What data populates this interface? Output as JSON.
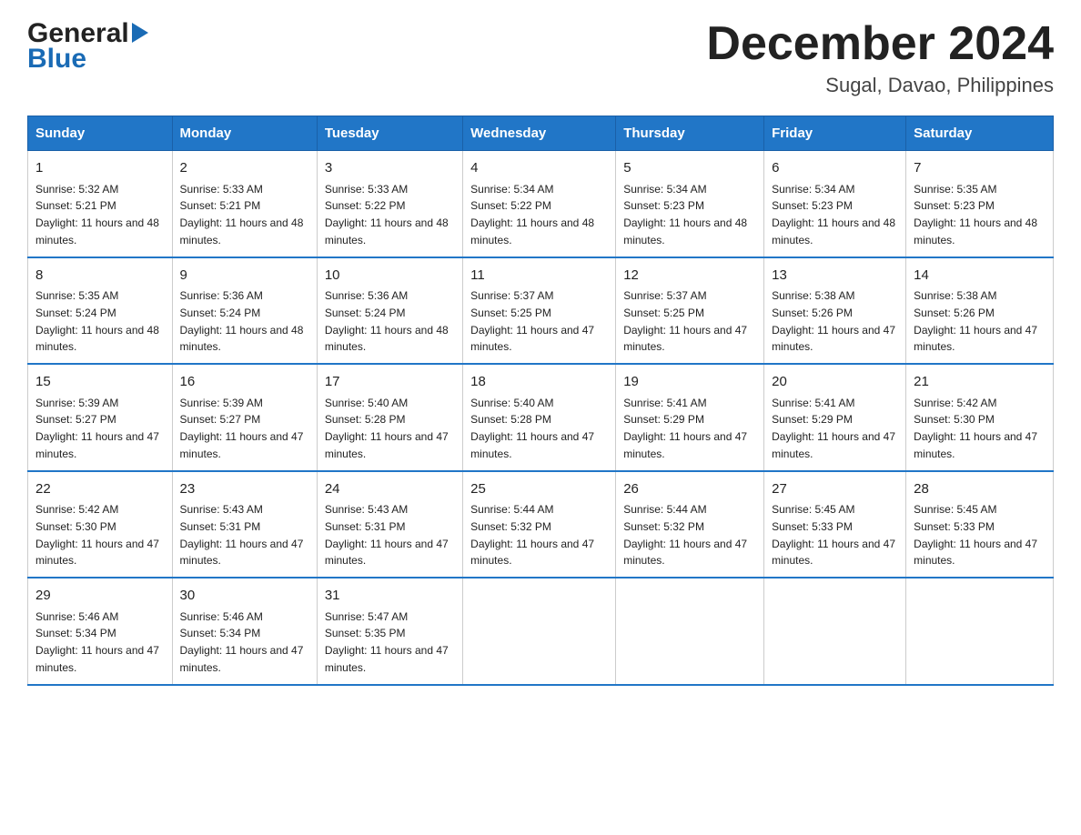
{
  "logo": {
    "general": "General",
    "arrow": "▶",
    "blue": "Blue"
  },
  "header": {
    "month_year": "December 2024",
    "location": "Sugal, Davao, Philippines"
  },
  "days_of_week": [
    "Sunday",
    "Monday",
    "Tuesday",
    "Wednesday",
    "Thursday",
    "Friday",
    "Saturday"
  ],
  "weeks": [
    [
      {
        "day": "1",
        "sunrise": "5:32 AM",
        "sunset": "5:21 PM",
        "daylight": "11 hours and 48 minutes."
      },
      {
        "day": "2",
        "sunrise": "5:33 AM",
        "sunset": "5:21 PM",
        "daylight": "11 hours and 48 minutes."
      },
      {
        "day": "3",
        "sunrise": "5:33 AM",
        "sunset": "5:22 PM",
        "daylight": "11 hours and 48 minutes."
      },
      {
        "day": "4",
        "sunrise": "5:34 AM",
        "sunset": "5:22 PM",
        "daylight": "11 hours and 48 minutes."
      },
      {
        "day": "5",
        "sunrise": "5:34 AM",
        "sunset": "5:23 PM",
        "daylight": "11 hours and 48 minutes."
      },
      {
        "day": "6",
        "sunrise": "5:34 AM",
        "sunset": "5:23 PM",
        "daylight": "11 hours and 48 minutes."
      },
      {
        "day": "7",
        "sunrise": "5:35 AM",
        "sunset": "5:23 PM",
        "daylight": "11 hours and 48 minutes."
      }
    ],
    [
      {
        "day": "8",
        "sunrise": "5:35 AM",
        "sunset": "5:24 PM",
        "daylight": "11 hours and 48 minutes."
      },
      {
        "day": "9",
        "sunrise": "5:36 AM",
        "sunset": "5:24 PM",
        "daylight": "11 hours and 48 minutes."
      },
      {
        "day": "10",
        "sunrise": "5:36 AM",
        "sunset": "5:24 PM",
        "daylight": "11 hours and 48 minutes."
      },
      {
        "day": "11",
        "sunrise": "5:37 AM",
        "sunset": "5:25 PM",
        "daylight": "11 hours and 47 minutes."
      },
      {
        "day": "12",
        "sunrise": "5:37 AM",
        "sunset": "5:25 PM",
        "daylight": "11 hours and 47 minutes."
      },
      {
        "day": "13",
        "sunrise": "5:38 AM",
        "sunset": "5:26 PM",
        "daylight": "11 hours and 47 minutes."
      },
      {
        "day": "14",
        "sunrise": "5:38 AM",
        "sunset": "5:26 PM",
        "daylight": "11 hours and 47 minutes."
      }
    ],
    [
      {
        "day": "15",
        "sunrise": "5:39 AM",
        "sunset": "5:27 PM",
        "daylight": "11 hours and 47 minutes."
      },
      {
        "day": "16",
        "sunrise": "5:39 AM",
        "sunset": "5:27 PM",
        "daylight": "11 hours and 47 minutes."
      },
      {
        "day": "17",
        "sunrise": "5:40 AM",
        "sunset": "5:28 PM",
        "daylight": "11 hours and 47 minutes."
      },
      {
        "day": "18",
        "sunrise": "5:40 AM",
        "sunset": "5:28 PM",
        "daylight": "11 hours and 47 minutes."
      },
      {
        "day": "19",
        "sunrise": "5:41 AM",
        "sunset": "5:29 PM",
        "daylight": "11 hours and 47 minutes."
      },
      {
        "day": "20",
        "sunrise": "5:41 AM",
        "sunset": "5:29 PM",
        "daylight": "11 hours and 47 minutes."
      },
      {
        "day": "21",
        "sunrise": "5:42 AM",
        "sunset": "5:30 PM",
        "daylight": "11 hours and 47 minutes."
      }
    ],
    [
      {
        "day": "22",
        "sunrise": "5:42 AM",
        "sunset": "5:30 PM",
        "daylight": "11 hours and 47 minutes."
      },
      {
        "day": "23",
        "sunrise": "5:43 AM",
        "sunset": "5:31 PM",
        "daylight": "11 hours and 47 minutes."
      },
      {
        "day": "24",
        "sunrise": "5:43 AM",
        "sunset": "5:31 PM",
        "daylight": "11 hours and 47 minutes."
      },
      {
        "day": "25",
        "sunrise": "5:44 AM",
        "sunset": "5:32 PM",
        "daylight": "11 hours and 47 minutes."
      },
      {
        "day": "26",
        "sunrise": "5:44 AM",
        "sunset": "5:32 PM",
        "daylight": "11 hours and 47 minutes."
      },
      {
        "day": "27",
        "sunrise": "5:45 AM",
        "sunset": "5:33 PM",
        "daylight": "11 hours and 47 minutes."
      },
      {
        "day": "28",
        "sunrise": "5:45 AM",
        "sunset": "5:33 PM",
        "daylight": "11 hours and 47 minutes."
      }
    ],
    [
      {
        "day": "29",
        "sunrise": "5:46 AM",
        "sunset": "5:34 PM",
        "daylight": "11 hours and 47 minutes."
      },
      {
        "day": "30",
        "sunrise": "5:46 AM",
        "sunset": "5:34 PM",
        "daylight": "11 hours and 47 minutes."
      },
      {
        "day": "31",
        "sunrise": "5:47 AM",
        "sunset": "5:35 PM",
        "daylight": "11 hours and 47 minutes."
      },
      null,
      null,
      null,
      null
    ]
  ]
}
